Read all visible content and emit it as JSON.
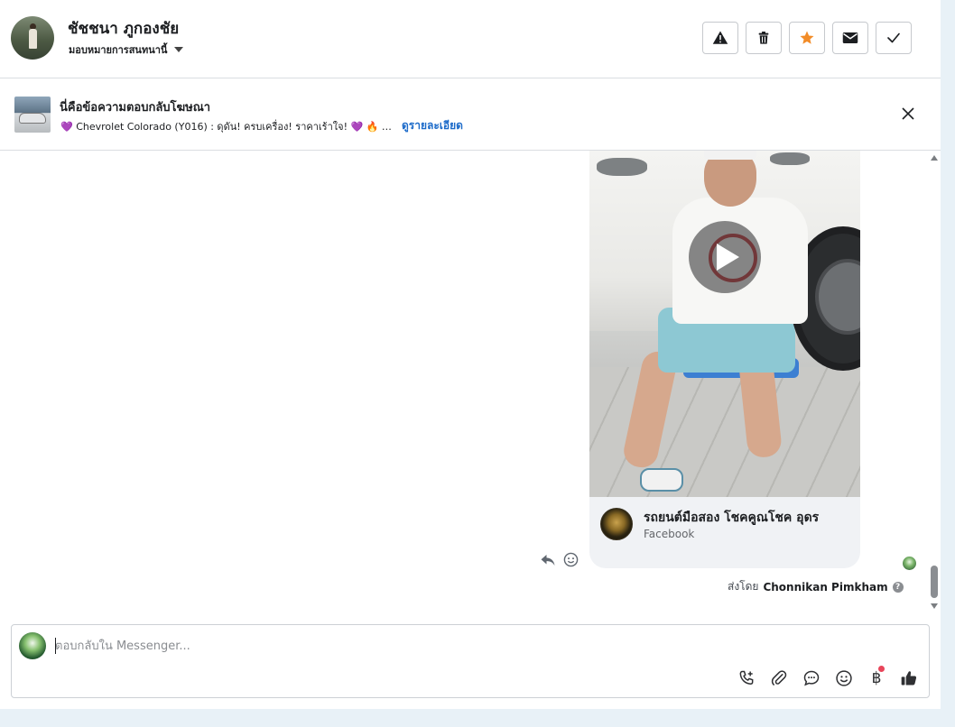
{
  "header": {
    "contact_name": "ชัชชนา ภูกองชัย",
    "assign_label": "มอบหมายการสนทนานี้",
    "actions": [
      {
        "name": "report-spam",
        "icon": "warning-triangle-icon"
      },
      {
        "name": "delete",
        "icon": "trash-icon"
      },
      {
        "name": "star",
        "icon": "star-icon",
        "color": "#f28c28"
      },
      {
        "name": "mark-unread",
        "icon": "envelope-icon"
      },
      {
        "name": "mark-done",
        "icon": "checkmark-icon"
      }
    ]
  },
  "ad_banner": {
    "title": "นี่คือข้อความตอบกลับโฆษณา",
    "description": "💜 Chevrolet Colorado (Y016) : ดุดัน! ครบเครื่อง! ราคาเร้าใจ! 💜 🔥 โปรโมชั่นพิเศษ",
    "link_label": "ดูรายละเอียด",
    "thumbnail_icon": "car-thumbnail"
  },
  "message": {
    "page_name": "รถยนต์มือสอง โชคคูณโชค อุดร",
    "page_source": "Facebook",
    "play_icon": "play-icon",
    "sent_by_prefix": "ส่งโดย",
    "sent_by_name": "Chonnikan Pimkham",
    "help_mark": "?"
  },
  "composer": {
    "placeholder": "ตอบกลับใน Messenger...",
    "value": "",
    "tools": [
      "call-add-icon",
      "paperclip-icon",
      "saved-reply-icon",
      "emoji-icon",
      "baht-payment-icon",
      "thumbs-up-icon"
    ],
    "baht_symbol": "฿"
  },
  "colors": {
    "accent_link": "#1b6ac9",
    "star": "#f28c28",
    "notification_dot": "#e8455a"
  }
}
